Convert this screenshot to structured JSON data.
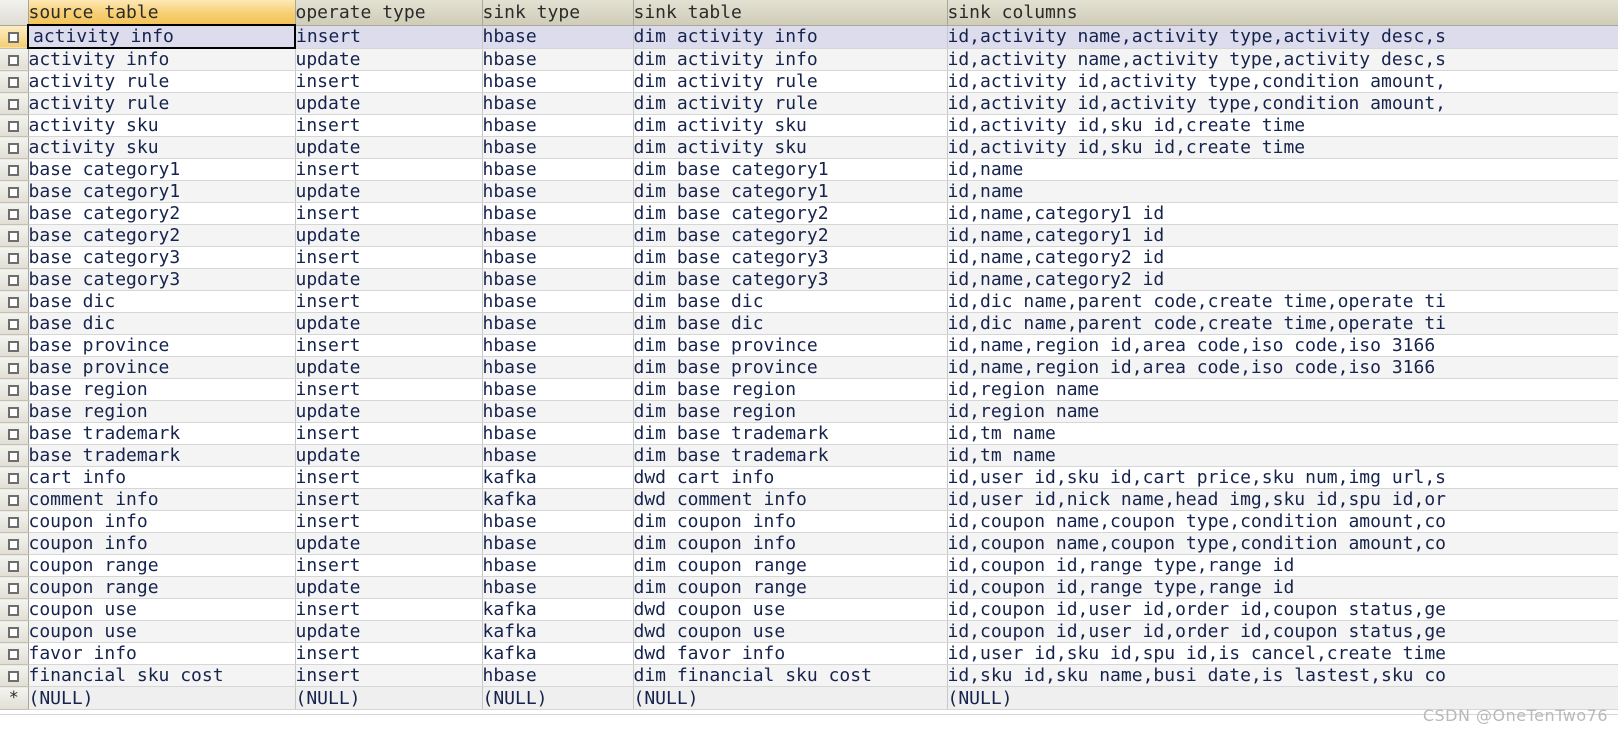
{
  "grid": {
    "row_header_new_marker": "*",
    "checkbox_icon": "checkbox-icon",
    "null_text": "(NULL)",
    "colors": {
      "sorted_header": "#f3c558",
      "header": "#cfccb8",
      "selected_row": "#dcdced",
      "alt_row": "#f4f4f4",
      "text": "#16234d",
      "focus_border": "#000000"
    },
    "columns": [
      {
        "key": "source_table",
        "label": "source table",
        "sorted": true
      },
      {
        "key": "operate_type",
        "label": "operate type",
        "sorted": false
      },
      {
        "key": "sink_type",
        "label": "sink type",
        "sorted": false
      },
      {
        "key": "sink_table",
        "label": "sink table",
        "sorted": false
      },
      {
        "key": "sink_columns",
        "label": "sink columns",
        "sorted": false
      }
    ],
    "rows": [
      {
        "source_table": "activity info",
        "operate_type": "insert",
        "sink_type": "hbase",
        "sink_table": "dim activity info",
        "sink_columns": "id,activity name,activity type,activity desc,s",
        "selected": true
      },
      {
        "source_table": "activity info",
        "operate_type": "update",
        "sink_type": "hbase",
        "sink_table": "dim activity info",
        "sink_columns": "id,activity name,activity type,activity desc,s",
        "selected": false
      },
      {
        "source_table": "activity rule",
        "operate_type": "insert",
        "sink_type": "hbase",
        "sink_table": "dim activity rule",
        "sink_columns": "id,activity id,activity type,condition amount,",
        "selected": false
      },
      {
        "source_table": "activity rule",
        "operate_type": "update",
        "sink_type": "hbase",
        "sink_table": "dim activity rule",
        "sink_columns": "id,activity id,activity type,condition amount,",
        "selected": false
      },
      {
        "source_table": "activity sku",
        "operate_type": "insert",
        "sink_type": "hbase",
        "sink_table": "dim activity sku",
        "sink_columns": "id,activity id,sku id,create time",
        "selected": false
      },
      {
        "source_table": "activity sku",
        "operate_type": "update",
        "sink_type": "hbase",
        "sink_table": "dim activity sku",
        "sink_columns": "id,activity id,sku id,create time",
        "selected": false
      },
      {
        "source_table": "base category1",
        "operate_type": "insert",
        "sink_type": "hbase",
        "sink_table": "dim base category1",
        "sink_columns": "id,name",
        "selected": false
      },
      {
        "source_table": "base category1",
        "operate_type": "update",
        "sink_type": "hbase",
        "sink_table": "dim base category1",
        "sink_columns": "id,name",
        "selected": false
      },
      {
        "source_table": "base category2",
        "operate_type": "insert",
        "sink_type": "hbase",
        "sink_table": "dim base category2",
        "sink_columns": "id,name,category1 id",
        "selected": false
      },
      {
        "source_table": "base category2",
        "operate_type": "update",
        "sink_type": "hbase",
        "sink_table": "dim base category2",
        "sink_columns": "id,name,category1 id",
        "selected": false
      },
      {
        "source_table": "base category3",
        "operate_type": "insert",
        "sink_type": "hbase",
        "sink_table": "dim base category3",
        "sink_columns": "id,name,category2 id",
        "selected": false
      },
      {
        "source_table": "base category3",
        "operate_type": "update",
        "sink_type": "hbase",
        "sink_table": "dim base category3",
        "sink_columns": "id,name,category2 id",
        "selected": false
      },
      {
        "source_table": "base dic",
        "operate_type": "insert",
        "sink_type": "hbase",
        "sink_table": "dim base dic",
        "sink_columns": "id,dic name,parent code,create time,operate ti",
        "selected": false
      },
      {
        "source_table": "base dic",
        "operate_type": "update",
        "sink_type": "hbase",
        "sink_table": "dim base dic",
        "sink_columns": "id,dic name,parent code,create time,operate ti",
        "selected": false
      },
      {
        "source_table": "base province",
        "operate_type": "insert",
        "sink_type": "hbase",
        "sink_table": "dim base province",
        "sink_columns": "id,name,region id,area code,iso code,iso 3166 ",
        "selected": false
      },
      {
        "source_table": "base province",
        "operate_type": "update",
        "sink_type": "hbase",
        "sink_table": "dim base province",
        "sink_columns": "id,name,region id,area code,iso code,iso 3166 ",
        "selected": false
      },
      {
        "source_table": "base region",
        "operate_type": "insert",
        "sink_type": "hbase",
        "sink_table": "dim base region",
        "sink_columns": "id,region name",
        "selected": false
      },
      {
        "source_table": "base region",
        "operate_type": "update",
        "sink_type": "hbase",
        "sink_table": "dim base region",
        "sink_columns": "id,region name",
        "selected": false
      },
      {
        "source_table": "base trademark",
        "operate_type": "insert",
        "sink_type": "hbase",
        "sink_table": "dim base trademark",
        "sink_columns": "id,tm name",
        "selected": false
      },
      {
        "source_table": "base trademark",
        "operate_type": "update",
        "sink_type": "hbase",
        "sink_table": "dim base trademark",
        "sink_columns": "id,tm name",
        "selected": false
      },
      {
        "source_table": "cart info",
        "operate_type": "insert",
        "sink_type": "kafka",
        "sink_table": "dwd cart info",
        "sink_columns": "id,user id,sku id,cart price,sku num,img url,s",
        "selected": false
      },
      {
        "source_table": "comment info",
        "operate_type": "insert",
        "sink_type": "kafka",
        "sink_table": "dwd comment info",
        "sink_columns": "id,user id,nick name,head img,sku id,spu id,or",
        "selected": false
      },
      {
        "source_table": "coupon info",
        "operate_type": "insert",
        "sink_type": "hbase",
        "sink_table": "dim coupon info",
        "sink_columns": "id,coupon name,coupon type,condition amount,co",
        "selected": false
      },
      {
        "source_table": "coupon info",
        "operate_type": "update",
        "sink_type": "hbase",
        "sink_table": "dim coupon info",
        "sink_columns": "id,coupon name,coupon type,condition amount,co",
        "selected": false
      },
      {
        "source_table": "coupon range",
        "operate_type": "insert",
        "sink_type": "hbase",
        "sink_table": "dim coupon range",
        "sink_columns": "id,coupon id,range type,range id",
        "selected": false
      },
      {
        "source_table": "coupon range",
        "operate_type": "update",
        "sink_type": "hbase",
        "sink_table": "dim coupon range",
        "sink_columns": "id,coupon id,range type,range id",
        "selected": false
      },
      {
        "source_table": "coupon use",
        "operate_type": "insert",
        "sink_type": "kafka",
        "sink_table": "dwd coupon use",
        "sink_columns": "id,coupon id,user id,order id,coupon status,ge",
        "selected": false
      },
      {
        "source_table": "coupon use",
        "operate_type": "update",
        "sink_type": "kafka",
        "sink_table": "dwd coupon use",
        "sink_columns": "id,coupon id,user id,order id,coupon status,ge",
        "selected": false
      },
      {
        "source_table": "favor info",
        "operate_type": "insert",
        "sink_type": "kafka",
        "sink_table": "dwd favor info",
        "sink_columns": "id,user id,sku id,spu id,is cancel,create time",
        "selected": false
      },
      {
        "source_table": "financial sku cost",
        "operate_type": "insert",
        "sink_type": "hbase",
        "sink_table": "dim financial sku cost",
        "sink_columns": "id,sku id,sku name,busi date,is lastest,sku co",
        "selected": false
      }
    ],
    "new_row": {
      "source_table": "(NULL)",
      "operate_type": "(NULL)",
      "sink_type": "(NULL)",
      "sink_table": "(NULL)",
      "sink_columns": "(NULL)"
    }
  },
  "watermark": {
    "text": "CSDN @OneTenTwo76"
  }
}
